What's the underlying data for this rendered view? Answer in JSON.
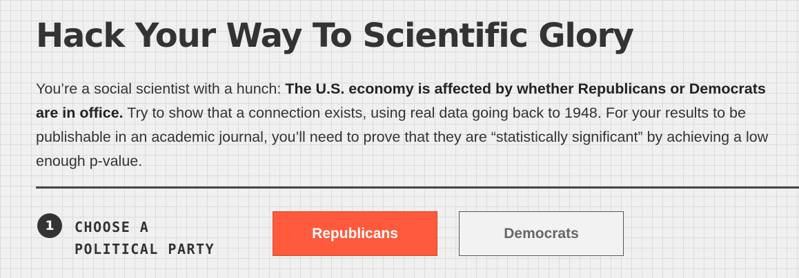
{
  "header": {
    "title": "Hack Your Way To Scientific Glory"
  },
  "intro": {
    "text_before": "You’re a social scientist with a hunch: ",
    "bold": "The U.S. economy is affected by whether Republicans or Democrats are in office.",
    "text_after": " Try to show that a connection exists, using real data going back to 1948. For your results to be publishable in an academic journal, you’ll need to prove that they are “statistically significant” by achieving a low enough p-value."
  },
  "step1": {
    "number": "1",
    "label_line1": "CHOOSE A",
    "label_line2": "POLITICAL PARTY",
    "options": [
      {
        "label": "Republicans",
        "selected": true
      },
      {
        "label": "Democrats",
        "selected": false
      }
    ]
  },
  "colors": {
    "selected": "#ff5a3c",
    "unselected": "#f2f2f2",
    "text": "#333333"
  }
}
